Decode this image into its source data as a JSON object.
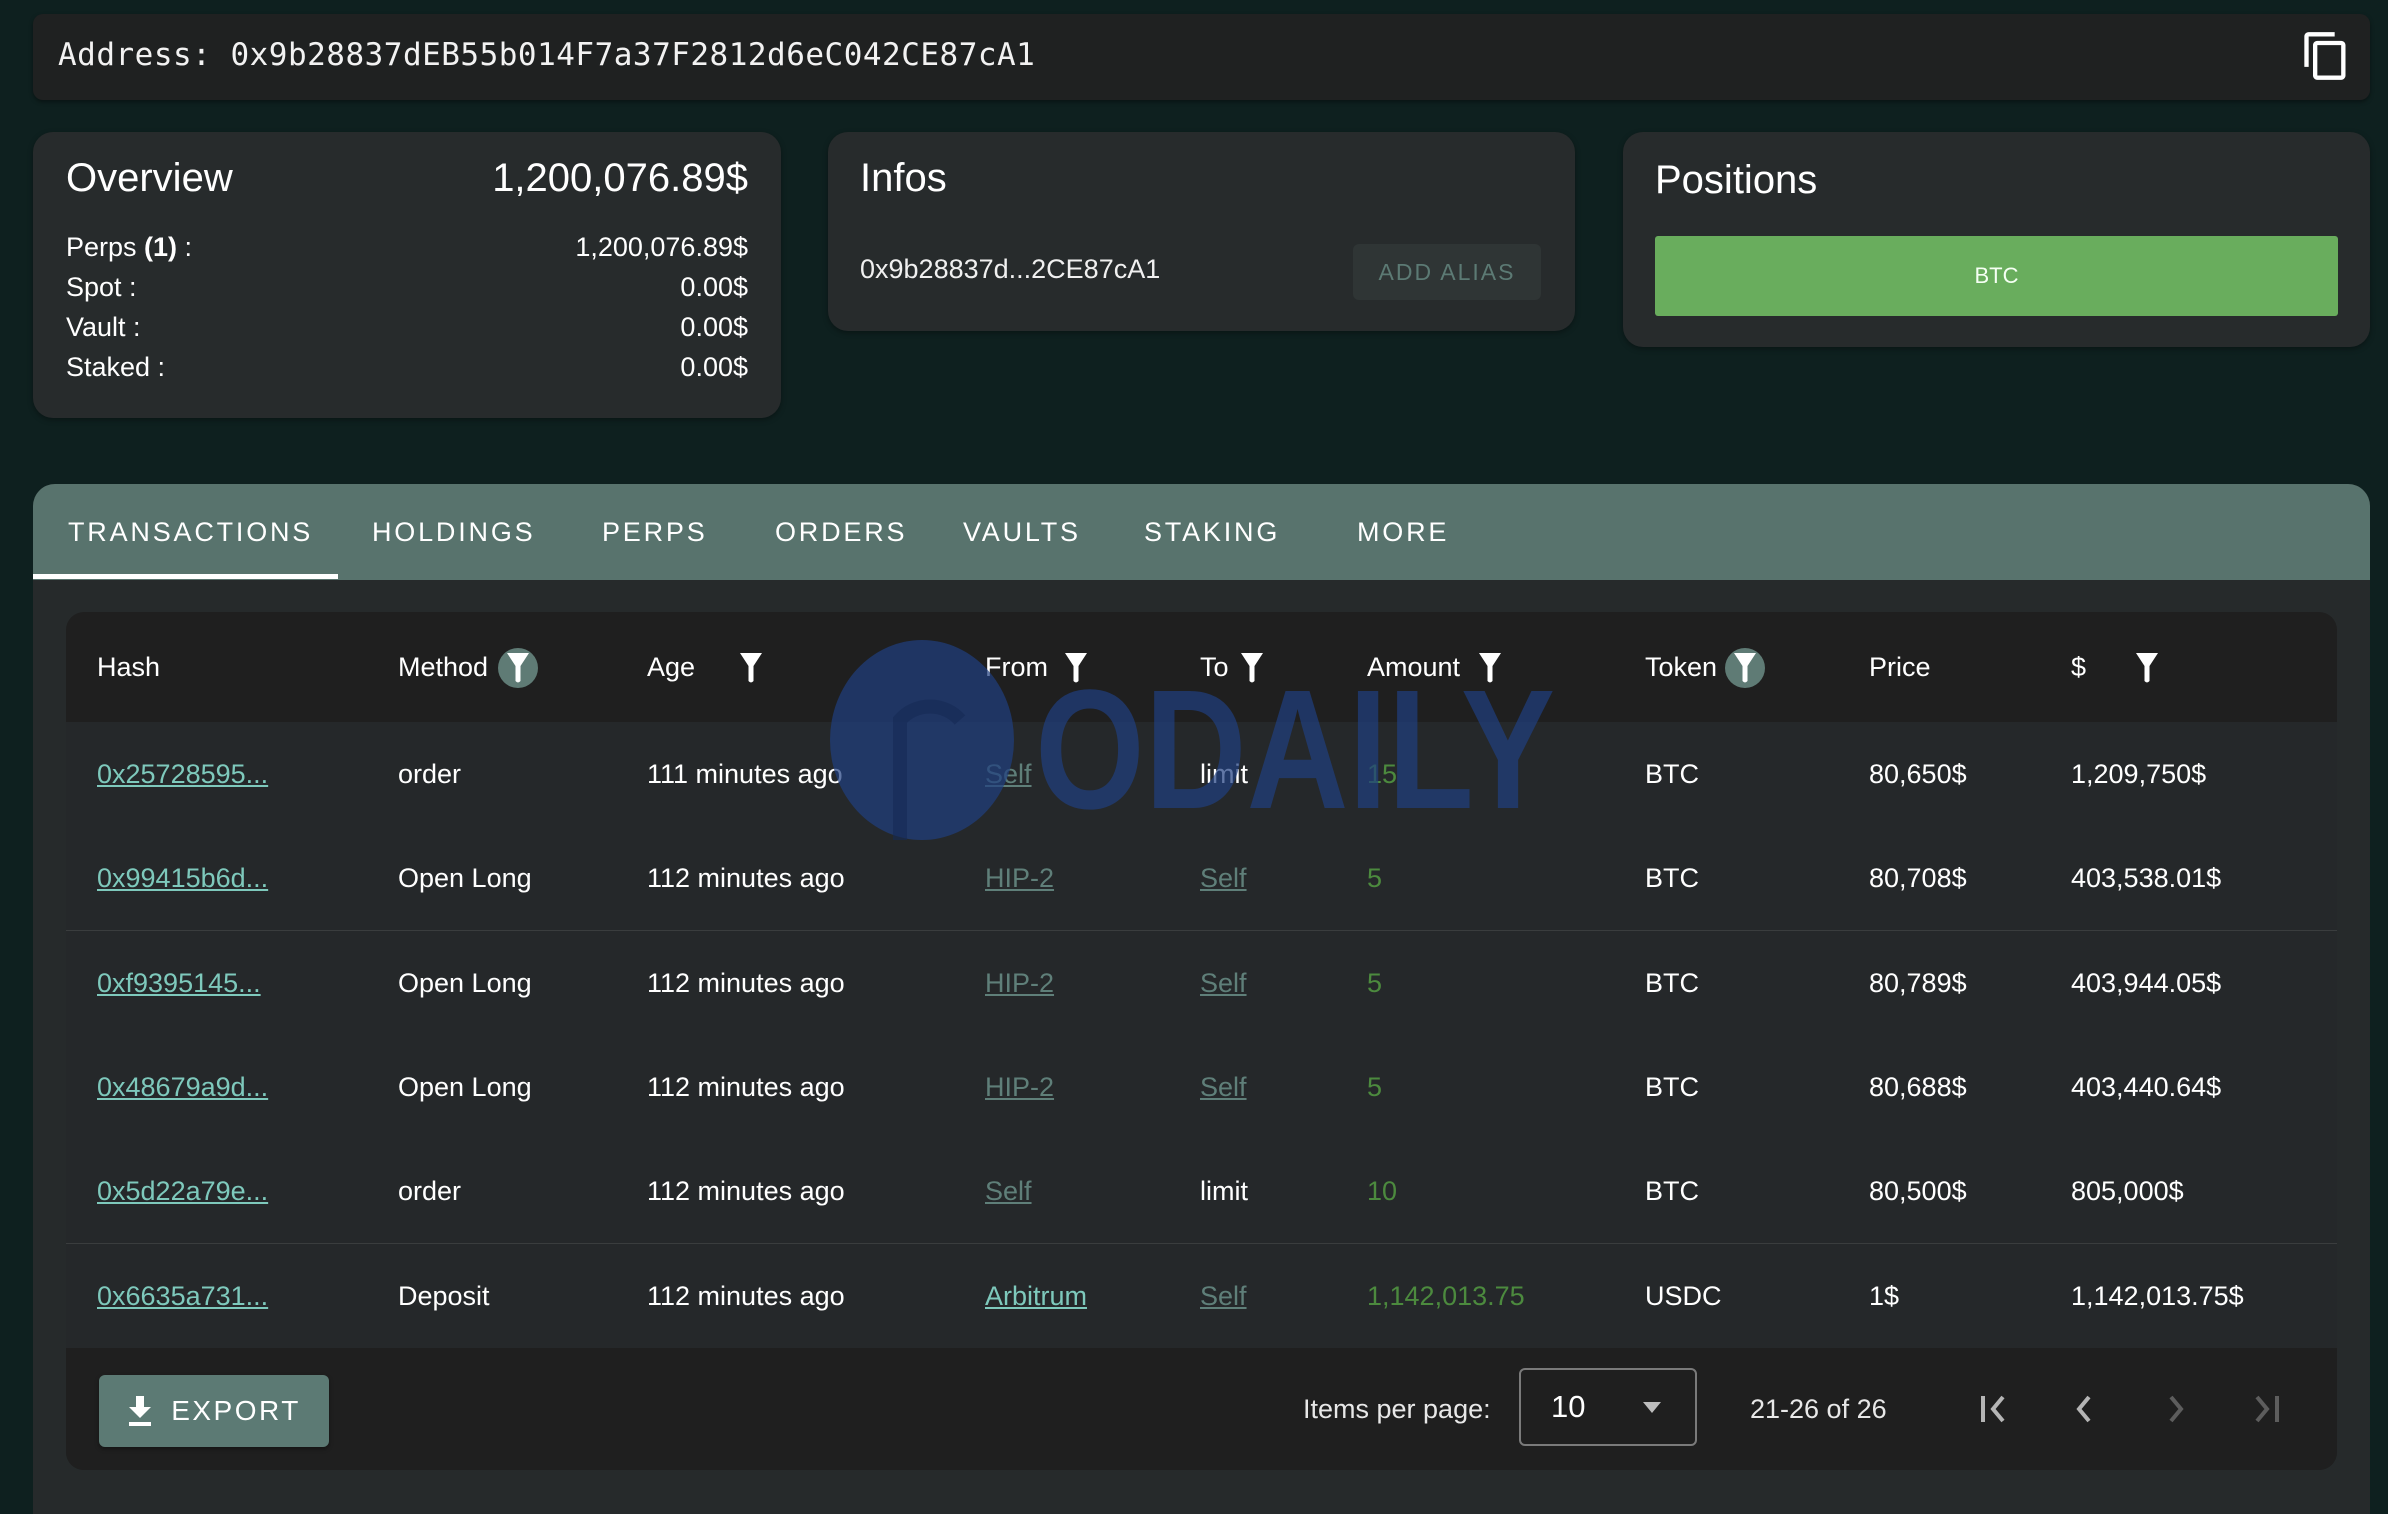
{
  "address_bar": {
    "label": "Address: 0x9b28837dEB55b014F7a37F2812d6eC042CE87cA1",
    "copy_icon": "copy-icon"
  },
  "overview": {
    "title": "Overview",
    "total": "1,200,076.89$",
    "rows": [
      {
        "label": "Perps ",
        "count": "(1)",
        "suffix": " :",
        "value": "1,200,076.89$"
      },
      {
        "label": "Spot :",
        "count": "",
        "suffix": "",
        "value": "0.00$"
      },
      {
        "label": "Vault :",
        "count": "",
        "suffix": "",
        "value": "0.00$"
      },
      {
        "label": "Staked :",
        "count": "",
        "suffix": "",
        "value": "0.00$"
      }
    ]
  },
  "infos": {
    "title": "Infos",
    "short_address": "0x9b28837d...2CE87cA1",
    "add_alias_label": "ADD ALIAS"
  },
  "positions": {
    "title": "Positions",
    "items": [
      {
        "label": "BTC",
        "color": "#69ad5d"
      }
    ]
  },
  "tabs": [
    {
      "label": "TRANSACTIONS",
      "active": true
    },
    {
      "label": "HOLDINGS",
      "active": false
    },
    {
      "label": "PERPS",
      "active": false
    },
    {
      "label": "ORDERS",
      "active": false
    },
    {
      "label": "VAULTS",
      "active": false
    },
    {
      "label": "STAKING",
      "active": false
    },
    {
      "label": "MORE",
      "active": false
    }
  ],
  "table": {
    "columns": [
      {
        "label": "Hash",
        "filter": false,
        "filter_active": false
      },
      {
        "label": "Method",
        "filter": true,
        "filter_active": true
      },
      {
        "label": "Age",
        "filter": true,
        "filter_active": false
      },
      {
        "label": "From",
        "filter": true,
        "filter_active": false
      },
      {
        "label": "To",
        "filter": true,
        "filter_active": false
      },
      {
        "label": "Amount",
        "filter": true,
        "filter_active": false
      },
      {
        "label": "Token",
        "filter": true,
        "filter_active": true
      },
      {
        "label": "Price",
        "filter": false,
        "filter_active": false
      },
      {
        "label": "$",
        "filter": true,
        "filter_active": false
      }
    ],
    "rows": [
      {
        "hash": "0x25728595...",
        "method": "order",
        "age": "111 minutes ago",
        "from": "Self",
        "to": "limit",
        "amount": "15",
        "token": "BTC",
        "price": "80,650$",
        "usd": "1,209,750$"
      },
      {
        "hash": "0x99415b6d...",
        "method": "Open Long",
        "age": "112 minutes ago",
        "from": "HIP-2",
        "to": "Self",
        "amount": "5",
        "token": "BTC",
        "price": "80,708$",
        "usd": "403,538.01$"
      },
      {
        "hash": "0xf9395145...",
        "method": "Open Long",
        "age": "112 minutes ago",
        "from": "HIP-2",
        "to": "Self",
        "amount": "5",
        "token": "BTC",
        "price": "80,789$",
        "usd": "403,944.05$"
      },
      {
        "hash": "0x48679a9d...",
        "method": "Open Long",
        "age": "112 minutes ago",
        "from": "HIP-2",
        "to": "Self",
        "amount": "5",
        "token": "BTC",
        "price": "80,688$",
        "usd": "403,440.64$"
      },
      {
        "hash": "0x5d22a79e...",
        "method": "order",
        "age": "112 minutes ago",
        "from": "Self",
        "to": "limit",
        "amount": "10",
        "token": "BTC",
        "price": "80,500$",
        "usd": "805,000$"
      },
      {
        "hash": "0x6635a731...",
        "method": "Deposit",
        "age": "112 minutes ago",
        "from": "Arbitrum",
        "to": "Self",
        "amount": "1,142,013.75",
        "token": "USDC",
        "price": "1$",
        "usd": "1,142,013.75$"
      }
    ]
  },
  "footer": {
    "export_label": "EXPORT",
    "items_per_page_label": "Items per page:",
    "items_per_page_value": "10",
    "range_label": "21-26 of 26"
  },
  "watermark": "ODAILY",
  "colors": {
    "background": "#0e201f",
    "tab_bar": "#58736d",
    "link": "#7ec9bc",
    "amount": "#4c8a3e",
    "position_btc": "#69ad5d"
  }
}
